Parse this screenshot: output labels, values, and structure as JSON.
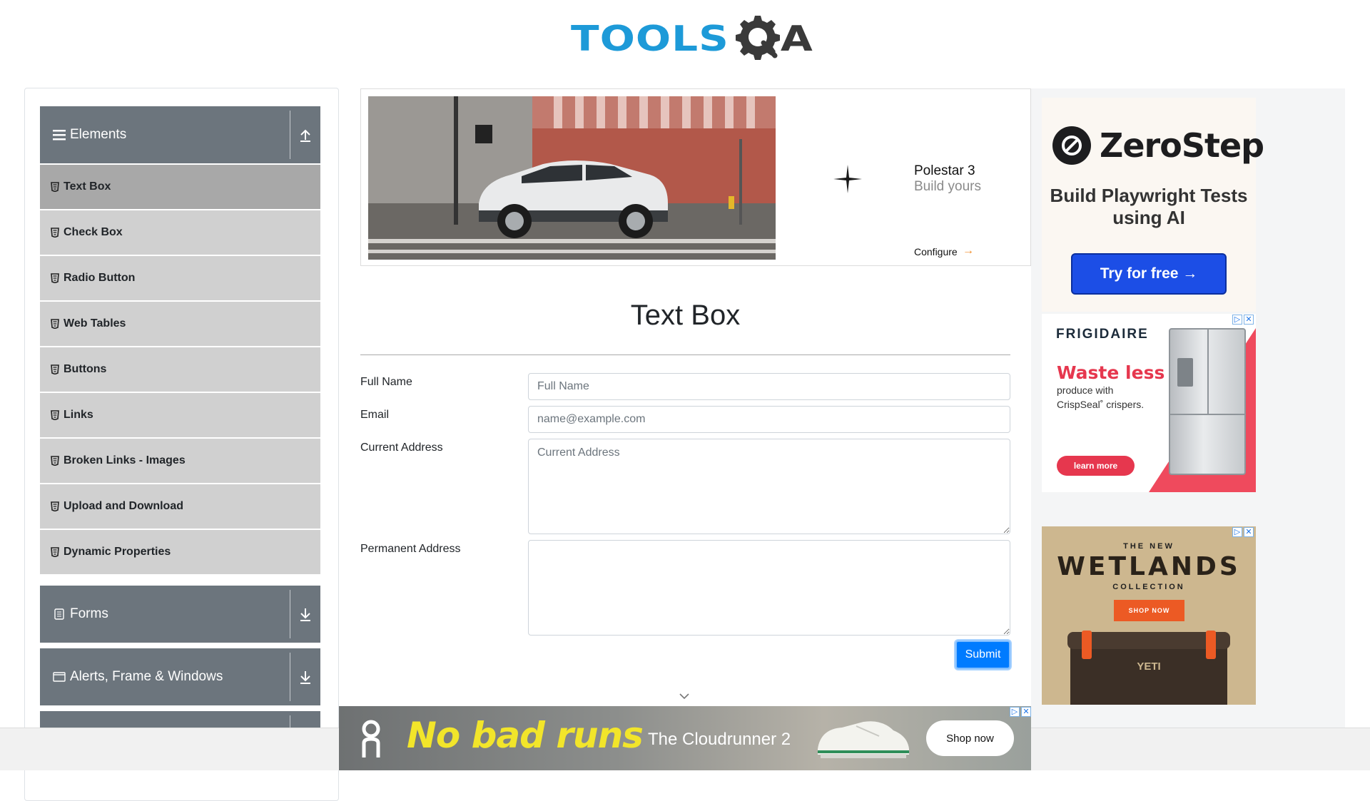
{
  "header": {
    "logo_text_left": "TOOLS",
    "logo_text_right": "A"
  },
  "sidebar": {
    "groups": [
      {
        "title": "Elements",
        "icon": "hamburger-icon",
        "state": "expanded"
      },
      {
        "title": "Forms",
        "icon": "document-icon",
        "state": "collapsed"
      },
      {
        "title": "Alerts, Frame & Windows",
        "icon": "window-icon",
        "state": "collapsed"
      }
    ],
    "items": [
      {
        "label": "Text Box",
        "active": true
      },
      {
        "label": "Check Box"
      },
      {
        "label": "Radio Button"
      },
      {
        "label": "Web Tables"
      },
      {
        "label": "Buttons"
      },
      {
        "label": "Links"
      },
      {
        "label": "Broken Links - Images"
      },
      {
        "label": "Upload and Download"
      },
      {
        "label": "Dynamic Properties"
      }
    ]
  },
  "top_ad": {
    "title": "Polestar 3",
    "subtitle": "Build yours",
    "cta": "Configure",
    "arrow": "→",
    "accent": "#f08a24"
  },
  "form": {
    "title": "Text Box",
    "fields": [
      {
        "label": "Full Name",
        "placeholder": "Full Name",
        "value": ""
      },
      {
        "label": "Email",
        "placeholder": "name@example.com",
        "value": ""
      },
      {
        "label": "Current Address",
        "placeholder": "Current Address",
        "value": ""
      },
      {
        "label": "Permanent Address",
        "placeholder": "",
        "value": ""
      }
    ],
    "submit_label": "Submit",
    "submit_color": "#007bff"
  },
  "ads": {
    "zerostep": {
      "name": "ZeroStep",
      "tagline": "Build Playwright Tests using AI",
      "cta": "Try for free →",
      "cta_color": "#1c4ee6"
    },
    "frigidaire": {
      "brand": "FRIGIDAIRE",
      "headline": "Waste less",
      "body_line1": "produce with",
      "body_line2": "CrispSeal˚ crispers.",
      "cta": "learn more",
      "accent": "#e6374e"
    },
    "yeti": {
      "line1": "THE NEW",
      "line2": "WETLANDS",
      "line3": "COLLECTION",
      "cta": "SHOP NOW",
      "cooler_brand": "YETI"
    },
    "on": {
      "headline": "No bad runs",
      "product": "The Cloudrunner 2",
      "cta": "Shop now",
      "headline_color": "#f2e52a"
    },
    "close_glyph": "✕",
    "adchoices_glyph": "▷"
  }
}
